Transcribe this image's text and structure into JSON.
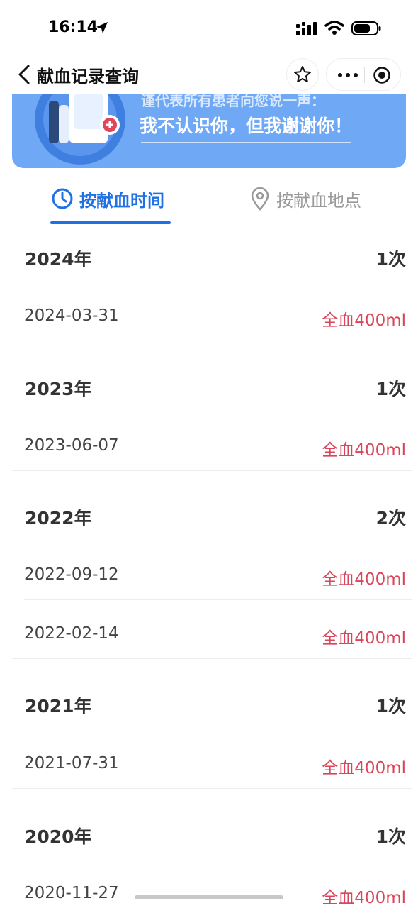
{
  "status": {
    "time": "16:14"
  },
  "nav": {
    "title": "献血记录查询"
  },
  "banner": {
    "line1": "谨代表所有患者向您说一声：",
    "line2": "我不认识你，但我谢谢你！"
  },
  "tabs": [
    {
      "label": "按献血时间",
      "active": true
    },
    {
      "label": "按献血地点",
      "active": false
    }
  ],
  "records": [
    {
      "year": "2024年",
      "count": "1次",
      "entries": [
        {
          "date": "2024-03-31",
          "type": "全血400ml"
        }
      ]
    },
    {
      "year": "2023年",
      "count": "1次",
      "entries": [
        {
          "date": "2023-06-07",
          "type": "全血400ml"
        }
      ]
    },
    {
      "year": "2022年",
      "count": "2次",
      "entries": [
        {
          "date": "2022-09-12",
          "type": "全血400ml"
        },
        {
          "date": "2022-02-14",
          "type": "全血400ml"
        }
      ]
    },
    {
      "year": "2021年",
      "count": "1次",
      "entries": [
        {
          "date": "2021-07-31",
          "type": "全血400ml"
        }
      ]
    },
    {
      "year": "2020年",
      "count": "1次",
      "entries": [
        {
          "date": "2020-11-27",
          "type": "全血400ml"
        }
      ]
    }
  ],
  "colors": {
    "accent": "#1f6fe5",
    "banner": "#6fa8f4",
    "record_type": "#d9465c"
  }
}
